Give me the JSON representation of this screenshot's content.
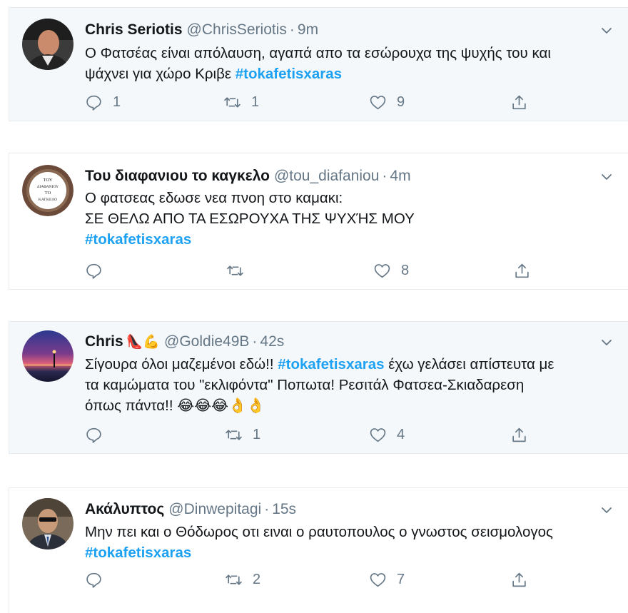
{
  "tweets": [
    {
      "name": "Chris Seriotis",
      "handle": "@ChrisSeriotis",
      "separator": "·",
      "time": "9m",
      "text_lines": [
        "Ο Φατσέας είναι απόλαυση, αγαπά απο τα εσώρουχα της ψυχής του και",
        "ψάχνει για χώρο Κριβε"
      ],
      "hashtag": "#tokafetisxaras",
      "replies": "1",
      "retweets": "1",
      "likes": "9",
      "avatar_icon": "avatar-man-photo"
    },
    {
      "name": "Του διαφανιου το καγκελο",
      "handle": "@tou_diafaniou",
      "separator": "·",
      "time": "4m",
      "text_lines": [
        "Ο φατσεας εδωσε νεα πνοη στο καμακι:",
        "ΣΕ ΘΕΛΩ ΑΠΟ ΤΑ ΕΣΩΡΟΥΧΑ ΤΗΣ ΨΥΧΉΣ ΜΟΥ"
      ],
      "hashtag": "#tokafetisxaras",
      "replies": "",
      "retweets": "",
      "likes": "8",
      "avatar_icon": "avatar-logo-badge",
      "avatar_text": [
        "ΤΟΥ",
        "ΔΙΑΦΑΝΙΟΥ",
        "ΤΟ",
        "ΚΑΓΚΕΛΟ"
      ]
    },
    {
      "name": "Chris",
      "name_emoji": "👠💪",
      "handle": "@Goldie49B",
      "separator": "·",
      "time": "42s",
      "text_pre": "Σίγουρα όλοι μαζεμένοι εδώ!!",
      "hashtag": "#tokafetisxaras",
      "text_post": "έχω γελάσει απίστευτα με",
      "text_lines": [
        "τα καμώματα του \"εκλιφόντα\" Ποπωτα! Ρεσιτάλ Φατσεα-Σκιαδαρεση",
        "όπως πάντα!!"
      ],
      "text_emoji": "😂😂😂👌👌",
      "replies": "",
      "retweets": "1",
      "likes": "4",
      "avatar_icon": "avatar-sunset-photo"
    },
    {
      "name": "Ακάλυπτος",
      "handle": "@Dinwepitagi",
      "separator": "·",
      "time": "15s",
      "text_lines": [
        "Μην πει και ο Θόδωρος  οτι ειναι ο ραυτοπουλος ο γνωστος σεισμολογος"
      ],
      "hashtag": "#tokafetisxaras",
      "replies": "",
      "retweets": "2",
      "likes": "7",
      "avatar_icon": "avatar-man-sunglasses-photo"
    }
  ],
  "colors": {
    "hashtag": "#1da1f2",
    "secondary_text": "#657786",
    "shaded_background": "#f5f8fa",
    "border": "#e6ecf0"
  },
  "icons": {
    "reply": "reply-icon",
    "retweet": "retweet-icon",
    "like": "heart-icon",
    "share": "share-icon",
    "more": "chevron-down-icon"
  }
}
